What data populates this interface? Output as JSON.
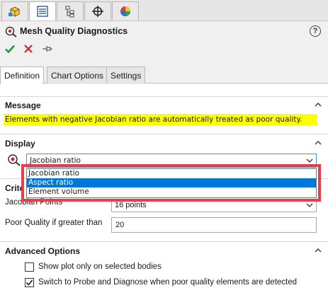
{
  "top_tabs": [
    {
      "icon": "part-cube-icon"
    },
    {
      "icon": "property-manager-icon"
    },
    {
      "icon": "configuration-tree-icon"
    },
    {
      "icon": "crosshair-icon"
    },
    {
      "icon": "appearance-pie-icon"
    }
  ],
  "header": {
    "title": "Mesh Quality Diagnostics",
    "help_label": "?"
  },
  "sub_tabs": [
    {
      "label": "Definition",
      "active": true
    },
    {
      "label": "Chart Options",
      "active": false
    },
    {
      "label": "Settings",
      "active": false
    }
  ],
  "message": {
    "heading": "Message",
    "text": "Elements with negative Jacobian ratio are automatically treated as poor quality."
  },
  "display": {
    "heading": "Display",
    "selected": "Jacobian ratio",
    "options": [
      "Jacobian ratio",
      "Aspect ratio",
      "Element volume"
    ],
    "highlighted_option": "Aspect ratio"
  },
  "criteria": {
    "heading": "Crite",
    "jacobian_label": "Jacobian Points",
    "jacobian_value": "16 points",
    "poor_quality_label": "Poor Quality if greater than",
    "poor_quality_value": "20"
  },
  "advanced": {
    "heading": "Advanced Options",
    "show_plot_label": "Show plot only on selected bodies",
    "show_plot_checked": false,
    "switch_probe_label": "Switch to Probe and Diagnose when poor quality elements are detected",
    "switch_probe_checked": true
  },
  "colors": {
    "accent_highlight": "#e8404a",
    "message_bg": "#ffff00",
    "selected_option_bg": "#0078d7",
    "ok_green": "#1a9a2a",
    "cancel_red": "#d0202a"
  }
}
